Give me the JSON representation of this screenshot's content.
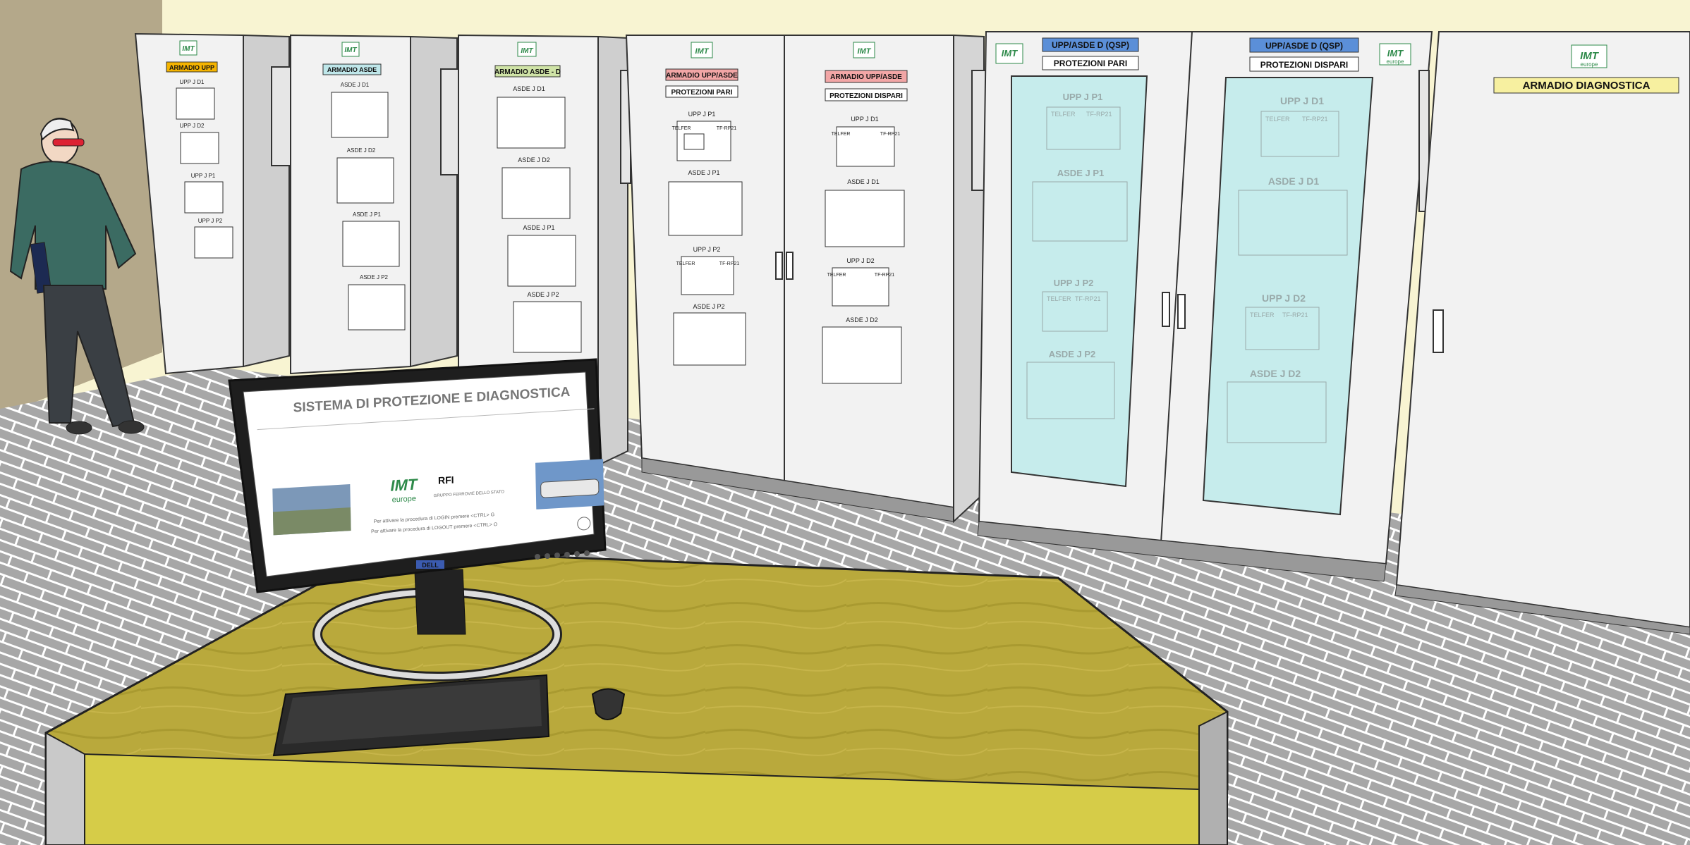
{
  "cabinets": {
    "upp": {
      "label": "ARMADIO UPP",
      "color": "#f5b400",
      "units": [
        "UPP J D1",
        "UPP J D2",
        "UPP J P1",
        "UPP J P2"
      ]
    },
    "asde": {
      "label": "ARMADIO ASDE",
      "color": "#bfe7ea",
      "units": [
        "ASDE J D1",
        "ASDE J D2",
        "ASDE J P1",
        "ASDE J P2"
      ]
    },
    "asde_d": {
      "label": "ARMADIO ASDE - D",
      "color": "#cfe3a6",
      "units": [
        "ASDE J D1",
        "ASDE J D2",
        "ASDE J P1",
        "ASDE J P2"
      ]
    },
    "upp_asde_pari": {
      "label": "ARMADIO UPP/ASDE",
      "sublabel": "PROTEZIONI PARI",
      "color": "#f2a6a6",
      "units": [
        "UPP J P1",
        "ASDE J P1",
        "UPP J P2",
        "ASDE J P2"
      ]
    },
    "upp_asde_dispari": {
      "label": "ARMADIO UPP/ASDE",
      "sublabel": "PROTEZIONI DISPARI",
      "color": "#f2a6a6",
      "units": [
        "UPP J D1",
        "ASDE J D1",
        "UPP J D2",
        "ASDE J D2"
      ]
    },
    "qsp_pari": {
      "label": "UPP/ASDE D (QSP)",
      "sublabel": "PROTEZIONI PARI",
      "color": "#5b8fd8",
      "units": [
        "UPP J P1",
        "ASDE J P1",
        "UPP J P2",
        "ASDE J P2"
      ]
    },
    "qsp_dispari": {
      "label": "UPP/ASDE D (QSP)",
      "sublabel": "PROTEZIONI DISPARI",
      "color": "#5b8fd8",
      "units": [
        "UPP J D1",
        "ASDE J D1",
        "UPP J D2",
        "ASDE J D2"
      ]
    },
    "diagnostica": {
      "label": "ARMADIO DIAGNOSTICA",
      "color": "#f7f0a0"
    }
  },
  "device": {
    "brand": "TELFER",
    "model": "TF-RP21"
  },
  "logo": {
    "main": "IMT",
    "sub": "europe"
  },
  "monitor": {
    "title": "SISTEMA DI PROTEZIONE E DIAGNOSTICA",
    "brand": "DELL",
    "rfi_name": "RFI",
    "rfi_group": "GRUPPO FERROVIE DELLO STATO",
    "login_line": "Per attivare la procedura di LOGIN premere <CTRL> G",
    "logout_line": "Per attivare la procedura di LOGOUT premere <CTRL> O"
  },
  "colors": {
    "wall": "#f8f4d2",
    "floor": "#a9a9a9",
    "cabinet": "#f2f2f2",
    "glass": "#c6ecec",
    "table": "#b8a83a"
  },
  "icons": [
    "person-icon",
    "logo-icon",
    "keyboard-icon",
    "mouse-icon",
    "monitor-icon",
    "train-photo-icon",
    "substation-photo-icon"
  ]
}
